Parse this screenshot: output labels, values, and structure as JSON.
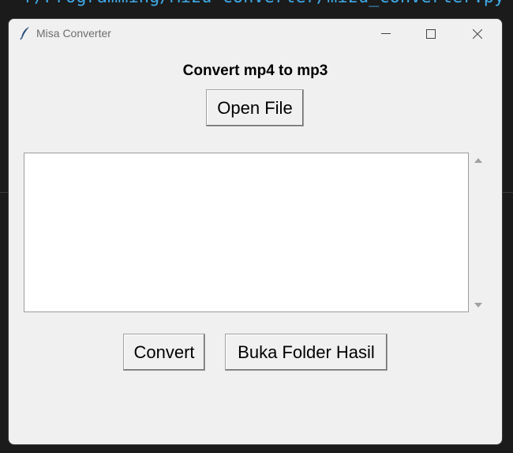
{
  "background": {
    "code_path": "r/Programming/Mizu-converter/mizu_converter.py"
  },
  "window": {
    "title": "Misa Converter",
    "app_icon": "feather-icon",
    "controls": {
      "minimize": "minimize-icon",
      "maximize": "maximize-icon",
      "close": "close-icon"
    }
  },
  "main": {
    "heading": "Convert mp4 to mp3",
    "open_button_label": "Open File",
    "output_text": "",
    "convert_button_label": "Convert",
    "open_folder_button_label": "Buka Folder Hasil"
  },
  "colors": {
    "code_text": "#3fa9e6",
    "window_bg": "#f0f0f0",
    "text_area_bg": "#ffffff"
  }
}
